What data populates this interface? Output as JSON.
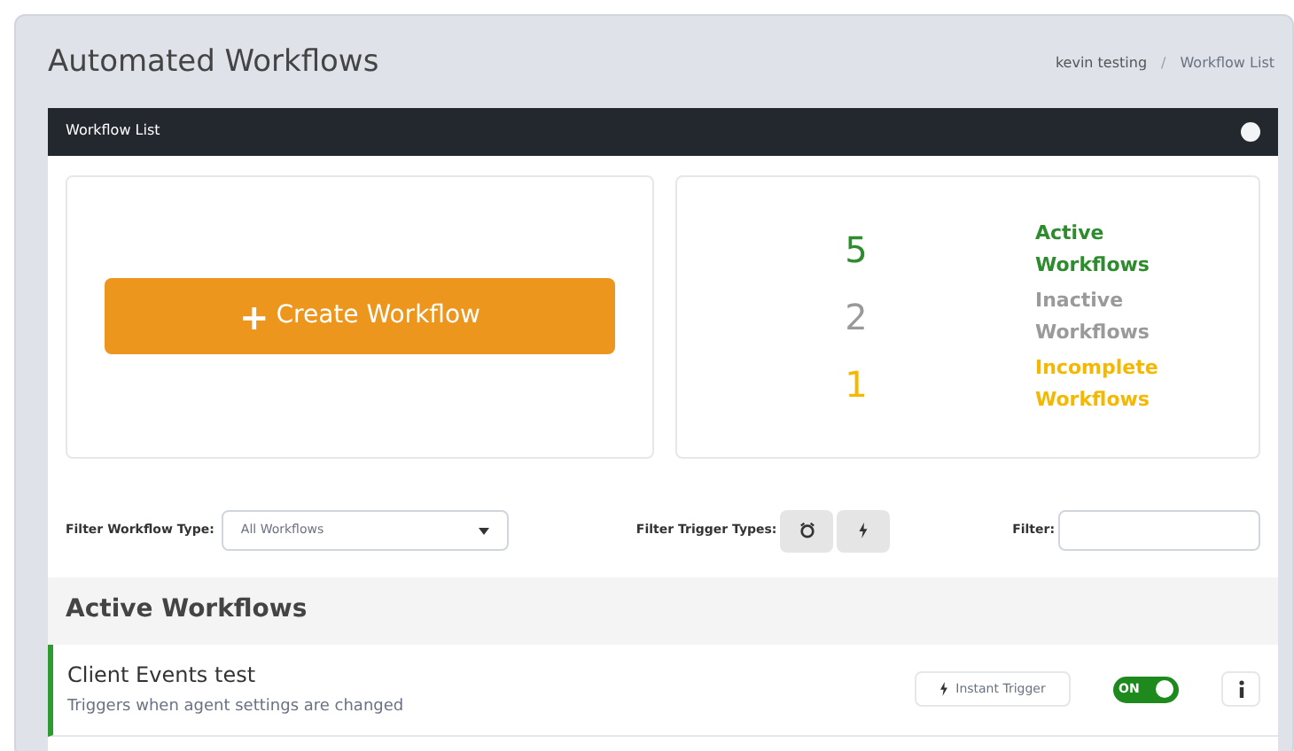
{
  "page_title": "Automated Workflows",
  "breadcrumb": [
    "kevin testing",
    "Workflow List"
  ],
  "breadcrumb_separator": "/",
  "panel": {
    "title": "Workflow List"
  },
  "create_button": {
    "label": "Create Workflow",
    "icon": "+"
  },
  "stats": [
    {
      "count": "5",
      "label": "Active Workflows",
      "color": "#2e8b2e"
    },
    {
      "count": "2",
      "label": "Inactive Workflows",
      "color": "#9a9a9a"
    },
    {
      "count": "1",
      "label": "Incomplete Workflows",
      "color": "#f5b800"
    }
  ],
  "filters": {
    "type_label": "Filter Workflow Type:",
    "type_value": "All Workflows",
    "trigger_label": "Filter Trigger Types:",
    "text_label": "Filter:"
  },
  "section_title": "Active Workflows",
  "workflows": [
    {
      "name": "Client Events test",
      "description": "Triggers when agent settings are changed",
      "trigger": "Instant Trigger",
      "on": true,
      "toggle_label": "ON"
    }
  ]
}
